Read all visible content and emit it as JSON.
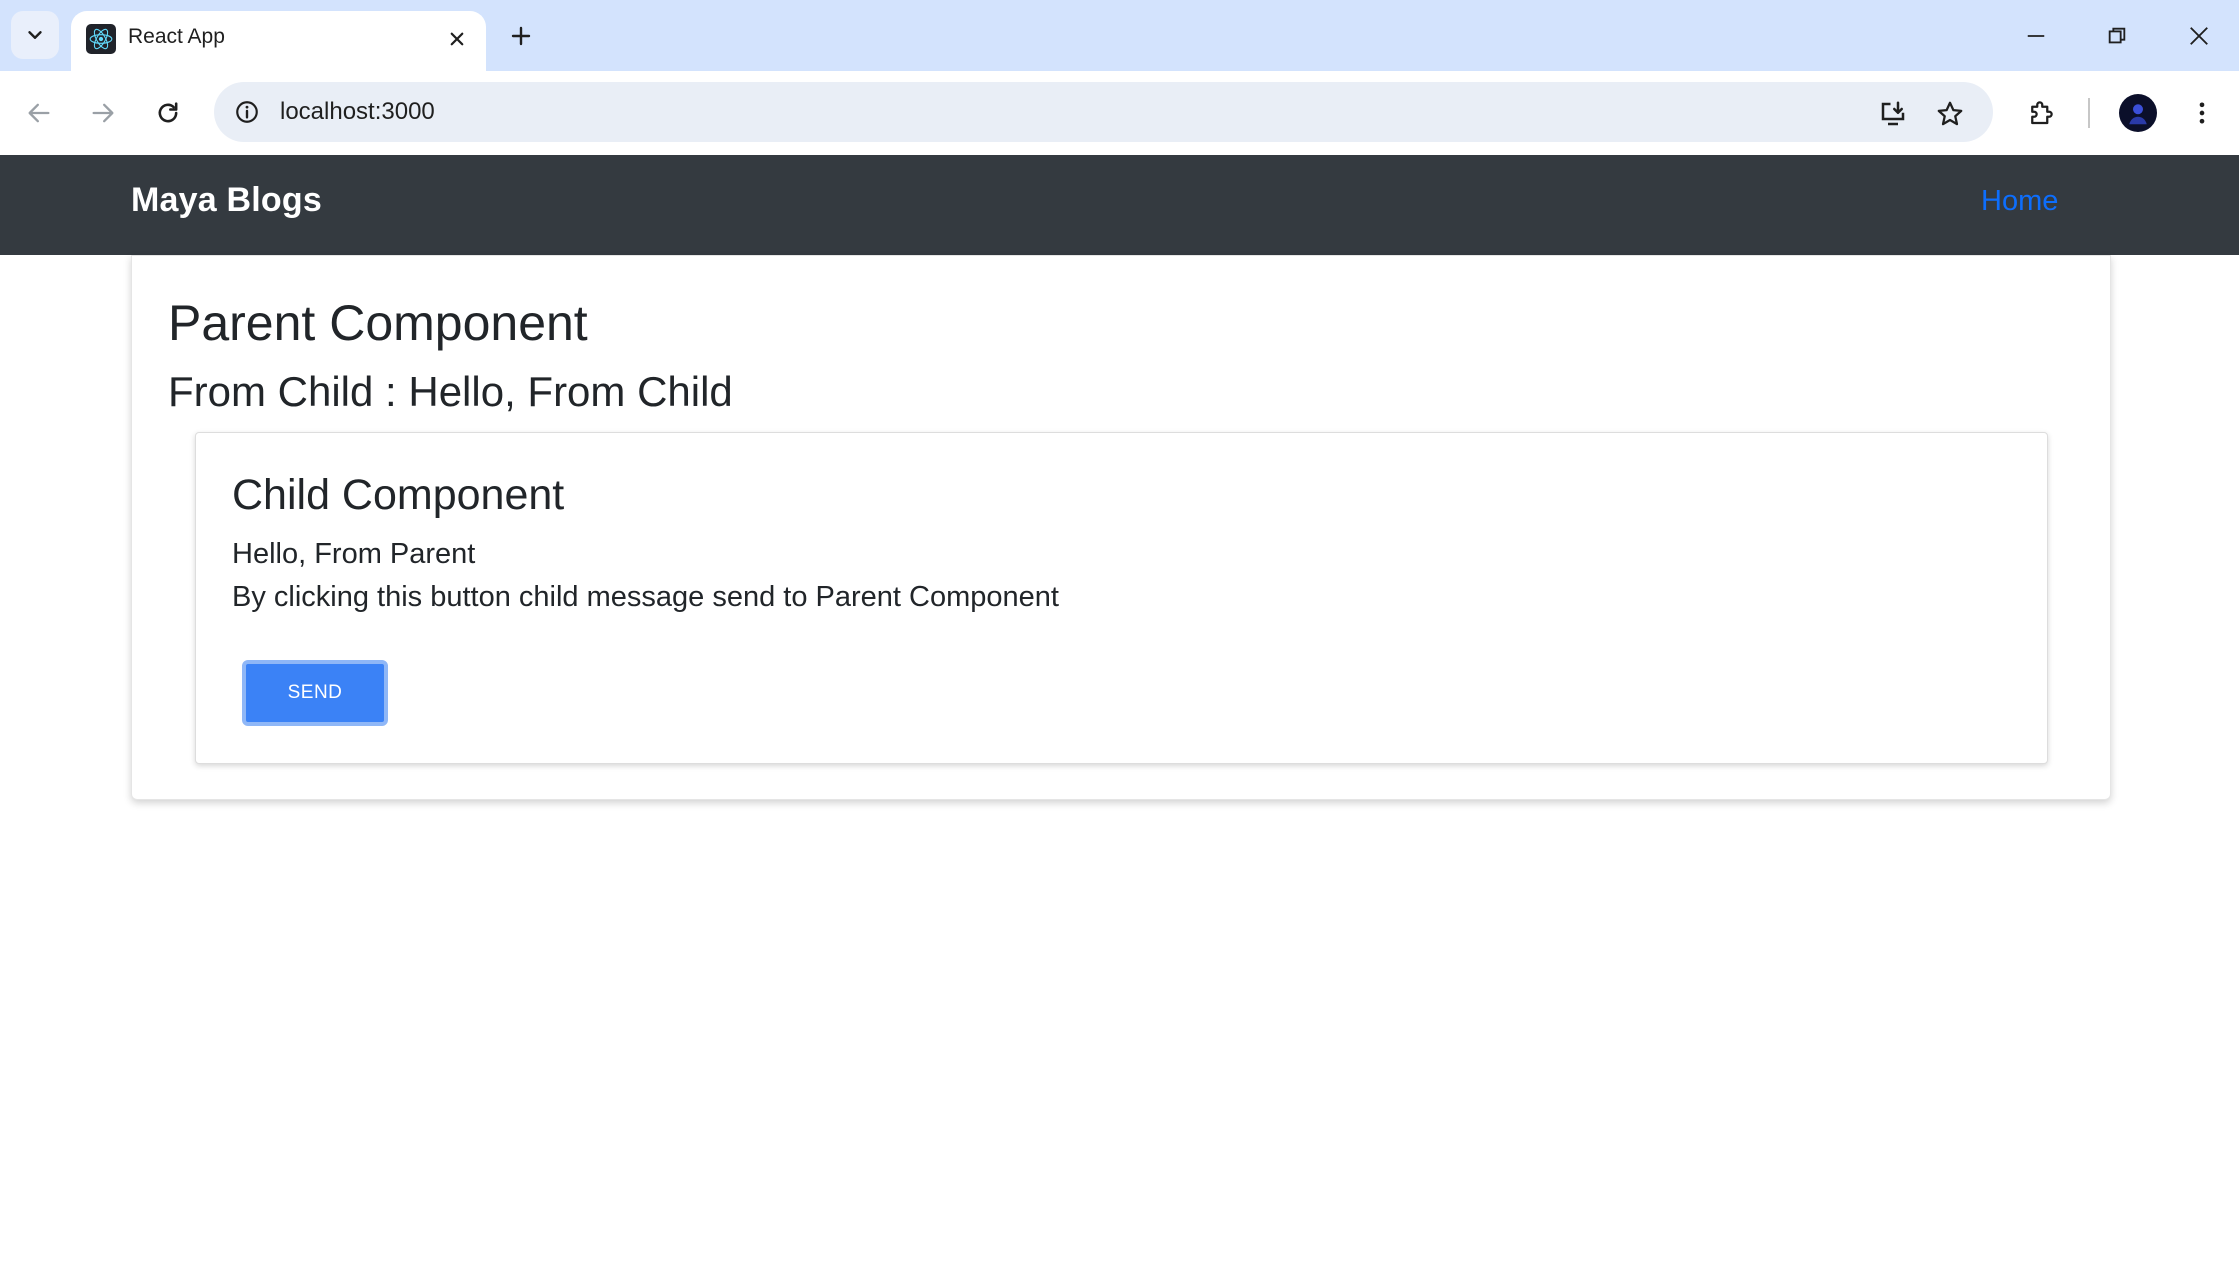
{
  "browser": {
    "tab": {
      "title": "React App",
      "favicon": "react-logo-icon"
    },
    "address_bar": {
      "url": "localhost:3000"
    },
    "colors": {
      "tab_strip": "#d3e3fd",
      "omnibox": "#e9eef6"
    }
  },
  "navbar": {
    "brand": "Maya Blogs",
    "links": [
      {
        "label": "Home"
      }
    ],
    "colors": {
      "background": "#343a40",
      "link": "#0d6efd"
    }
  },
  "parent": {
    "title": "Parent Component",
    "from_child_label": "From Child : Hello, From Child"
  },
  "child": {
    "title": "Child Component",
    "message": "Hello, From Parent",
    "description": "By clicking this button child message send to Parent Component",
    "button_label": "SEND",
    "colors": {
      "button": "#3b82f6"
    }
  }
}
